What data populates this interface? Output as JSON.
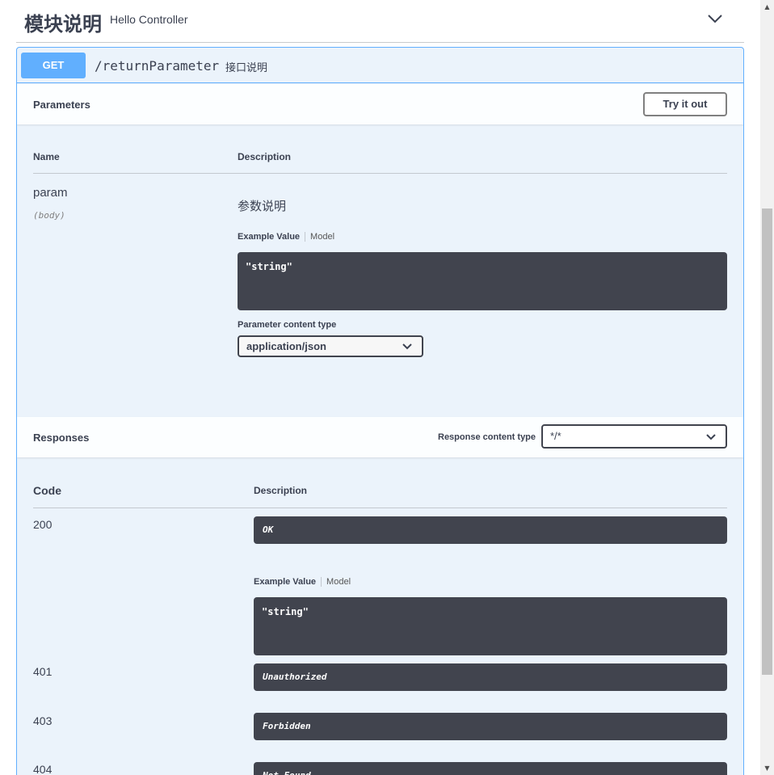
{
  "tag": {
    "title": "模块说明",
    "description": "Hello Controller",
    "chevron_icon": "chevron-down-icon"
  },
  "operation": {
    "method": "GET",
    "path": "/returnParameter",
    "summary": "接口说明",
    "method_color": "#61affe"
  },
  "parameters": {
    "section_title": "Parameters",
    "try_button": "Try it out",
    "col_name": "Name",
    "col_description": "Description",
    "items": [
      {
        "name": "param",
        "in": "(body)",
        "description": "参数说明",
        "tab_example": "Example Value",
        "tab_model": "Model",
        "example": "\"string\"",
        "content_type_label": "Parameter content type",
        "content_type_value": "application/json"
      }
    ]
  },
  "responses": {
    "section_title": "Responses",
    "content_type_label": "Response content type",
    "content_type_value": "*/*",
    "col_code": "Code",
    "col_description": "Description",
    "items": [
      {
        "code": "200",
        "description": "OK",
        "tab_example": "Example Value",
        "tab_model": "Model",
        "example": "\"string\""
      },
      {
        "code": "401",
        "description": "Unauthorized"
      },
      {
        "code": "403",
        "description": "Forbidden"
      },
      {
        "code": "404",
        "description": "Not Found"
      }
    ]
  }
}
